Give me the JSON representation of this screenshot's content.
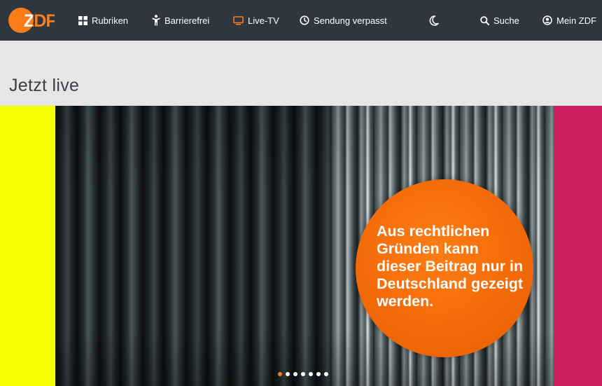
{
  "header": {
    "logo_text": "ZDF",
    "brand_color": "#fa7d19",
    "background": "#2f3640",
    "nav": [
      {
        "label": "Rubriken",
        "icon": "grid-icon",
        "active": false
      },
      {
        "label": "Barrierefrei",
        "icon": "accessibility-icon",
        "active": false
      },
      {
        "label": "Live-TV",
        "icon": "tv-icon",
        "active": true
      },
      {
        "label": "Sendung verpasst",
        "icon": "clock-icon",
        "active": false
      }
    ],
    "theme_toggle_icon": "moon-icon",
    "search_label": "Suche",
    "search_icon": "search-icon",
    "account_label": "Mein ZDF",
    "account_icon": "user-icon"
  },
  "page": {
    "title": "Jetzt live"
  },
  "player": {
    "geoblock_message": "Aus rechtlichen Gründen kann dieser Beitrag nur in Deutschland gezeigt werden.",
    "side_colors": {
      "left": "#f3ff00",
      "right": "#cc1f5f"
    },
    "carousel": {
      "count": 7,
      "active_index": 0
    }
  }
}
